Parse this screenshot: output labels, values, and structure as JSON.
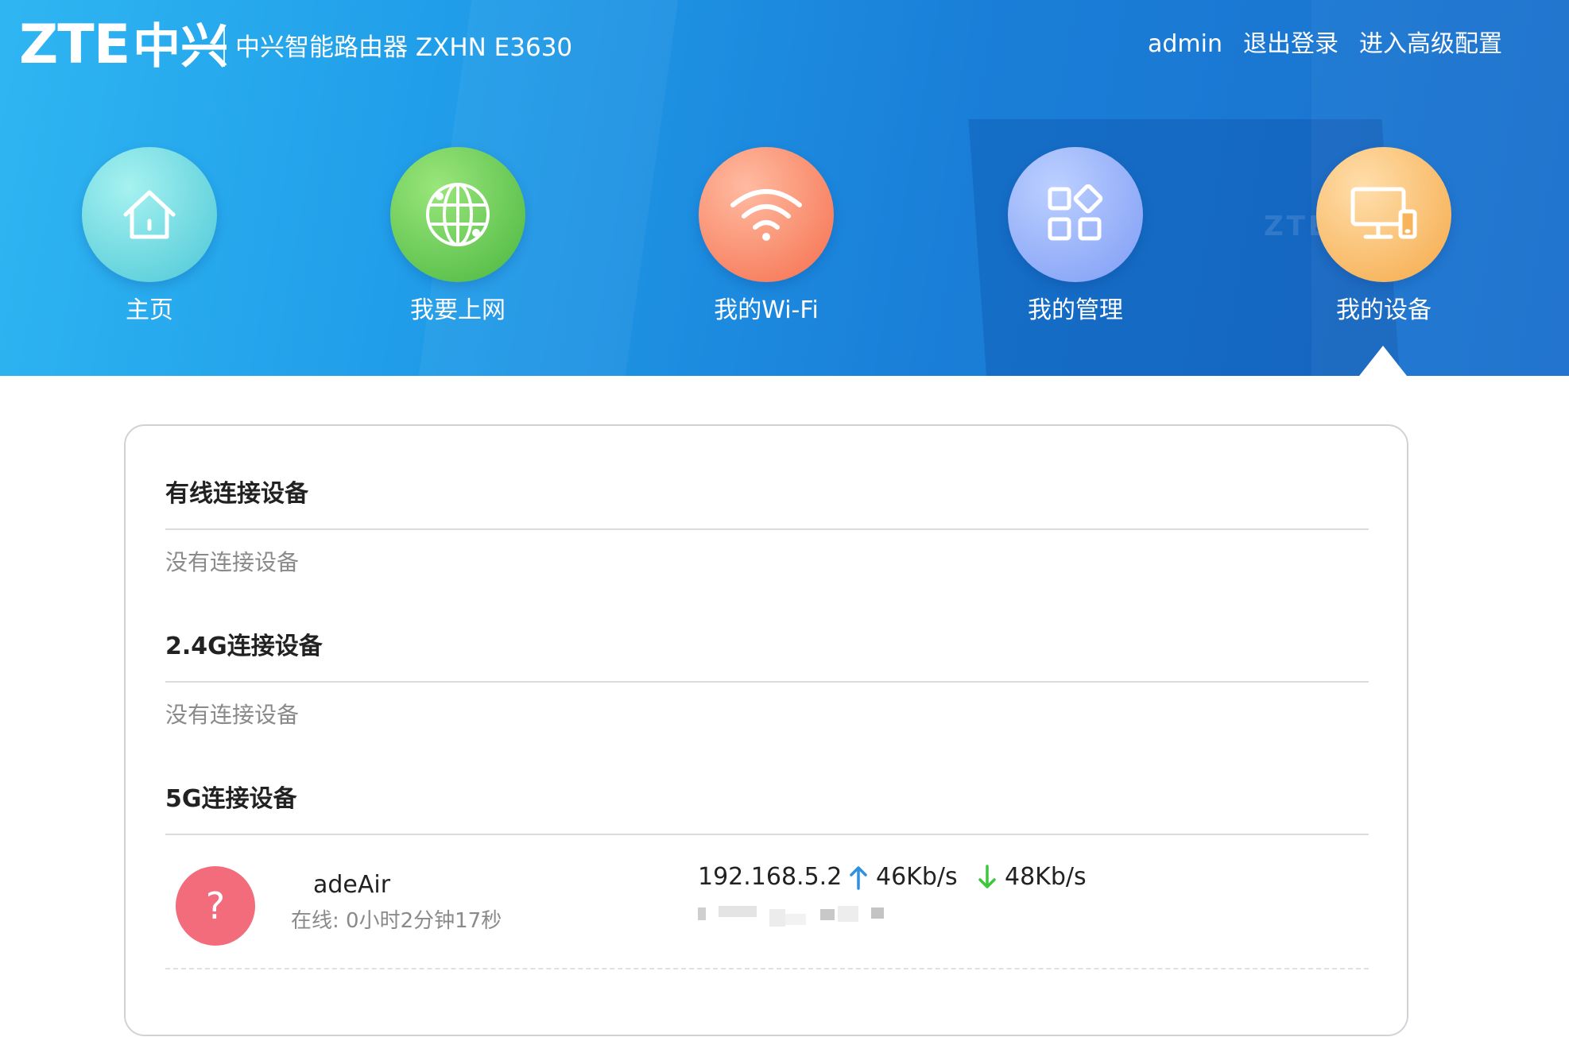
{
  "brand": {
    "logo_text": "ZTE中兴",
    "product_name": "中兴智能路由器 ZXHN E3630"
  },
  "top_links": {
    "user": "admin",
    "logout": "退出登录",
    "advanced": "进入高级配置"
  },
  "nav": {
    "active_index": 4,
    "items": [
      {
        "label": "主页",
        "icon": "home-icon",
        "color_from": "#9ff0ef",
        "color_to": "#4cc7d6"
      },
      {
        "label": "我要上网",
        "icon": "globe-icon",
        "color_from": "#92e273",
        "color_to": "#4ab640"
      },
      {
        "label": "我的Wi-Fi",
        "icon": "wifi-icon",
        "color_from": "#ffb49a",
        "color_to": "#f56f4c"
      },
      {
        "label": "我的管理",
        "icon": "apps-grid-icon",
        "color_from": "#b6ccff",
        "color_to": "#7e9cf5"
      },
      {
        "label": "我的设备",
        "icon": "devices-icon",
        "color_from": "#ffd9a3",
        "color_to": "#f5a948"
      }
    ]
  },
  "sections": {
    "wired": {
      "title": "有线连接设备",
      "empty_text": "没有连接设备"
    },
    "band24": {
      "title": "2.4G连接设备",
      "empty_text": "没有连接设备"
    },
    "band5": {
      "title": "5G连接设备",
      "devices": [
        {
          "avatar_icon": "question-icon",
          "avatar_symbol": "?",
          "avatar_color": "#f26c7b",
          "name": "adeAir",
          "online": "在线: 0小时2分钟17秒",
          "ip": "192.168.5.2",
          "upload": "46Kb/s",
          "download": "48Kb/s"
        }
      ]
    }
  },
  "colors": {
    "upload_arrow": "#2f8fe0",
    "download_arrow": "#3cc83c"
  }
}
